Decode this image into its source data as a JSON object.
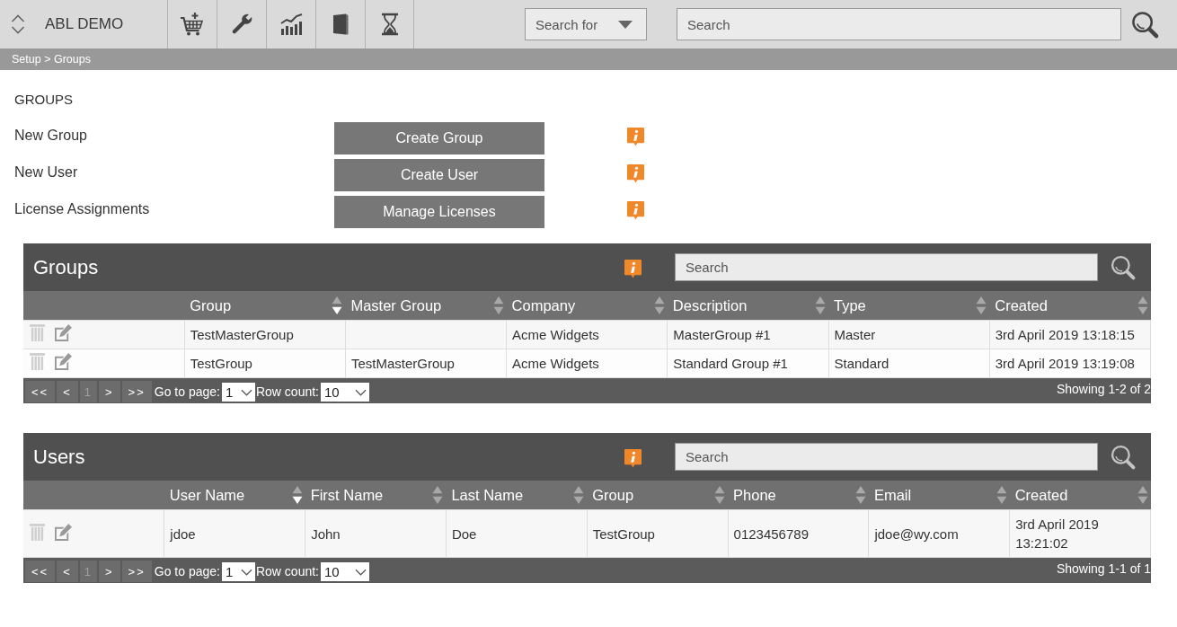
{
  "app": {
    "title": "ABL DEMO"
  },
  "toolbar_search": {
    "scope": "Search for",
    "placeholder": "Search"
  },
  "breadcrumb": "Setup > Groups",
  "heading": "GROUPS",
  "actions": [
    {
      "label": "New Group",
      "button": "Create Group"
    },
    {
      "label": "New User",
      "button": "Create User"
    },
    {
      "label": "License Assignments",
      "button": "Manage Licenses"
    }
  ],
  "panels": [
    {
      "title": "Groups",
      "search": {
        "placeholder": "Search"
      },
      "columns": [
        {
          "label": "Group",
          "sorted": true
        },
        {
          "label": "Master Group",
          "sorted": false
        },
        {
          "label": "Company",
          "sorted": false
        },
        {
          "label": "Description",
          "sorted": false
        },
        {
          "label": "Type",
          "sorted": false
        },
        {
          "label": "Created",
          "sorted": false
        }
      ],
      "rows": [
        {
          "cells": [
            "TestMasterGroup",
            null,
            "Acme Widgets",
            "MasterGroup #1",
            "Master",
            "3rd April 2019 13:18:15"
          ]
        },
        {
          "cells": [
            "TestGroup",
            "TestMasterGroup",
            "Acme Widgets",
            "Standard Group #1",
            "Standard",
            "3rd April 2019 13:19:08"
          ]
        }
      ],
      "pager": [
        {
          "label": "<<",
          "selected": false
        },
        {
          "label": "<",
          "selected": false
        },
        {
          "label": "1",
          "selected": true
        },
        {
          "label": ">",
          "selected": false
        },
        {
          "label": ">>",
          "selected": false
        }
      ],
      "go_to_page": {
        "label": "Go to page:",
        "value": "1"
      },
      "row_count": {
        "label": "Row count:",
        "value": "10"
      },
      "summary": "Showing 1-2 of 2"
    },
    {
      "title": "Users",
      "search": {
        "placeholder": "Search"
      },
      "columns": [
        {
          "label": "User Name",
          "sorted": true
        },
        {
          "label": "First Name",
          "sorted": false
        },
        {
          "label": "Last Name",
          "sorted": false
        },
        {
          "label": "Group",
          "sorted": false
        },
        {
          "label": "Phone",
          "sorted": false
        },
        {
          "label": "Email",
          "sorted": false
        },
        {
          "label": "Created",
          "sorted": false
        }
      ],
      "rows": [
        {
          "cells": [
            "jdoe",
            "John",
            "Doe",
            "TestGroup",
            "0123456789",
            "jdoe@wy.com",
            "3rd April 2019 13:21:02"
          ]
        }
      ],
      "pager": [
        {
          "label": "<<",
          "selected": false
        },
        {
          "label": "<",
          "selected": false
        },
        {
          "label": "1",
          "selected": true
        },
        {
          "label": ">",
          "selected": false
        },
        {
          "label": ">>",
          "selected": false
        }
      ],
      "go_to_page": {
        "label": "Go to page:",
        "value": "1"
      },
      "row_count": {
        "label": "Row count:",
        "value": "10"
      },
      "summary": "Showing 1-1 of 1"
    }
  ]
}
